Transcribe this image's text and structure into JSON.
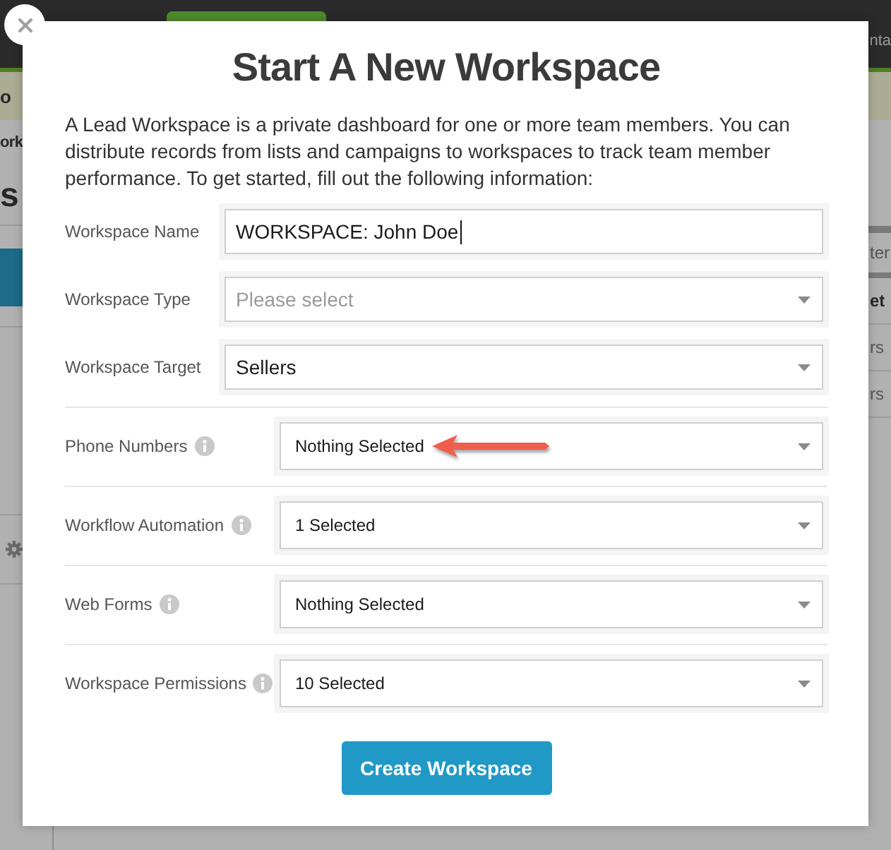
{
  "background": {
    "nav_text": "nta",
    "sidebar": {
      "banner_text": "o",
      "title": "ork",
      "heading": "s"
    },
    "table": {
      "toolbar_text": "ter",
      "column_header": "et",
      "rows": [
        "rs",
        "rs"
      ]
    }
  },
  "dialog": {
    "title": "Start A New Workspace",
    "description": "A Lead Workspace is a private dashboard for one or more team members. You can distribute records from lists and campaigns to workspaces to track team member performance. To get started, fill out the following information:",
    "fields": [
      {
        "kind": "text",
        "label": "Workspace Name",
        "value": "WORKSPACE: John Doe",
        "focused": true,
        "annotated": false
      },
      {
        "kind": "select",
        "label": "Workspace Type",
        "placeholder": "Please select",
        "annotated": false
      },
      {
        "kind": "select",
        "label": "Workspace Target",
        "value": "Sellers",
        "annotated": false
      },
      {
        "kind": "multiselect",
        "label": "Phone Numbers",
        "value": "Nothing Selected",
        "annotated": true
      },
      {
        "kind": "multiselect",
        "label": "Workflow Automation",
        "value": "1 Selected",
        "annotated": false
      },
      {
        "kind": "multiselect",
        "label": "Web Forms",
        "value": "Nothing Selected",
        "annotated": false
      },
      {
        "kind": "multiselect",
        "label": "Workspace Permissions",
        "value": "10 Selected",
        "annotated": false
      }
    ],
    "submit_button": "Create Workspace"
  }
}
